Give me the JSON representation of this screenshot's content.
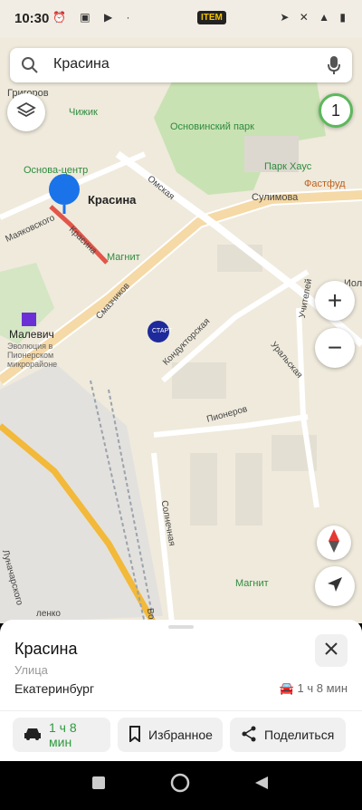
{
  "status_bar": {
    "time": "10:30",
    "chip": "ITEM"
  },
  "search": {
    "query": "Красина"
  },
  "map": {
    "markers_count_badge": "1",
    "labels": {
      "chizhik": "Чижик",
      "osnova": "Основа-центр",
      "krasina_pin": "Красина",
      "krasina_street": "Красина",
      "mayakovskogo": "Маяковского",
      "magnit1": "Магнит",
      "osnovinsky": "Основинский парк",
      "park_house": "Парк Хаус",
      "fastfud": "Фастфуд",
      "omskaya": "Омская",
      "sulimova": "Сулимова",
      "smazchikov": "Смазчиков",
      "malevich": "Малевич",
      "malevich_sub1": "Эволюция в",
      "malevich_sub2": "Пионерском",
      "malevich_sub3": "микрорайоне",
      "kondukt": "Кондукторская",
      "uralskaya": "Уральская",
      "uchiteley": "Учителей",
      "iol": "Иол",
      "pionerov": "Пионеров",
      "solnechnaya": "Солнечная",
      "lunacharskogo": "Луначарского",
      "magnit2": "Магнит",
      "start": "СТАРТ",
      "grigor": "Григоров",
      "lenko": "ленко",
      "vo": "Во"
    }
  },
  "place": {
    "title": "Красина",
    "subtitle": "Улица",
    "city": "Екатеринбург",
    "eta": "1 ч 8 мин"
  },
  "actions": {
    "route": "1 ч 8 мин",
    "favorite": "Избранное",
    "share": "Поделиться"
  }
}
